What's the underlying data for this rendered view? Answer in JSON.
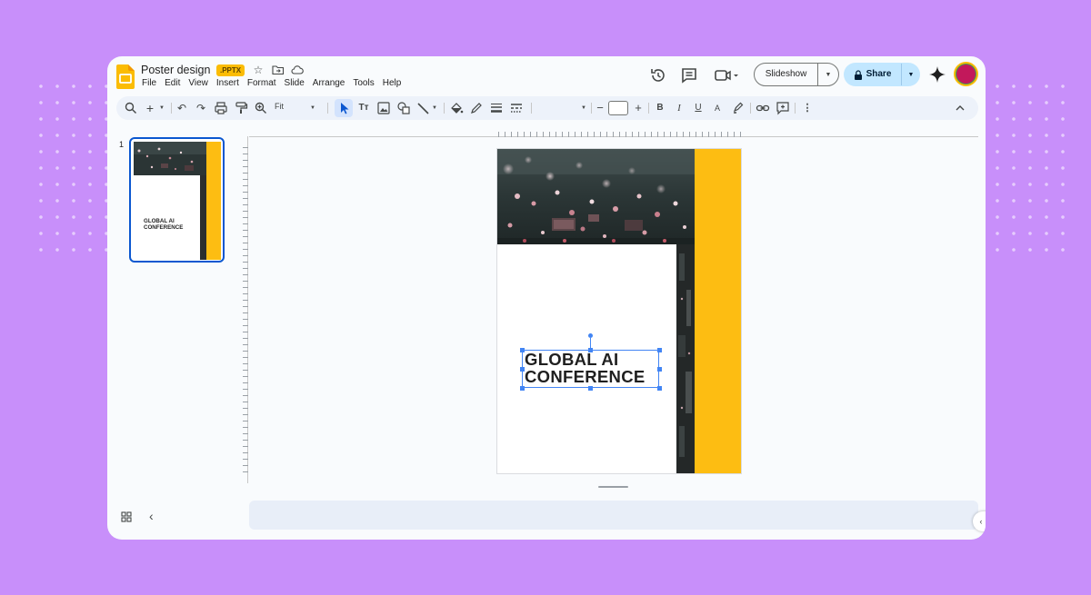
{
  "header": {
    "doc_title": "Poster design",
    "badge": ".PPTX",
    "menu": [
      "File",
      "Edit",
      "View",
      "Insert",
      "Format",
      "Slide",
      "Arrange",
      "Tools",
      "Help"
    ],
    "slideshow_label": "Slideshow",
    "share_label": "Share"
  },
  "toolbar": {
    "zoom_label": "Fit"
  },
  "filmstrip": {
    "slide_number": "1",
    "thumb_line1": "GLOBAL AI",
    "thumb_line2": "CONFERENCE"
  },
  "slide": {
    "headline_line1": "GLOBAL AI",
    "headline_line2": "CONFERENCE"
  },
  "colors": {
    "background": "#c88ffa",
    "accent_yellow": "#fdbd12",
    "selection": "#4285f4",
    "share_bg": "#c2e7ff",
    "badge": "#fbbc04"
  }
}
